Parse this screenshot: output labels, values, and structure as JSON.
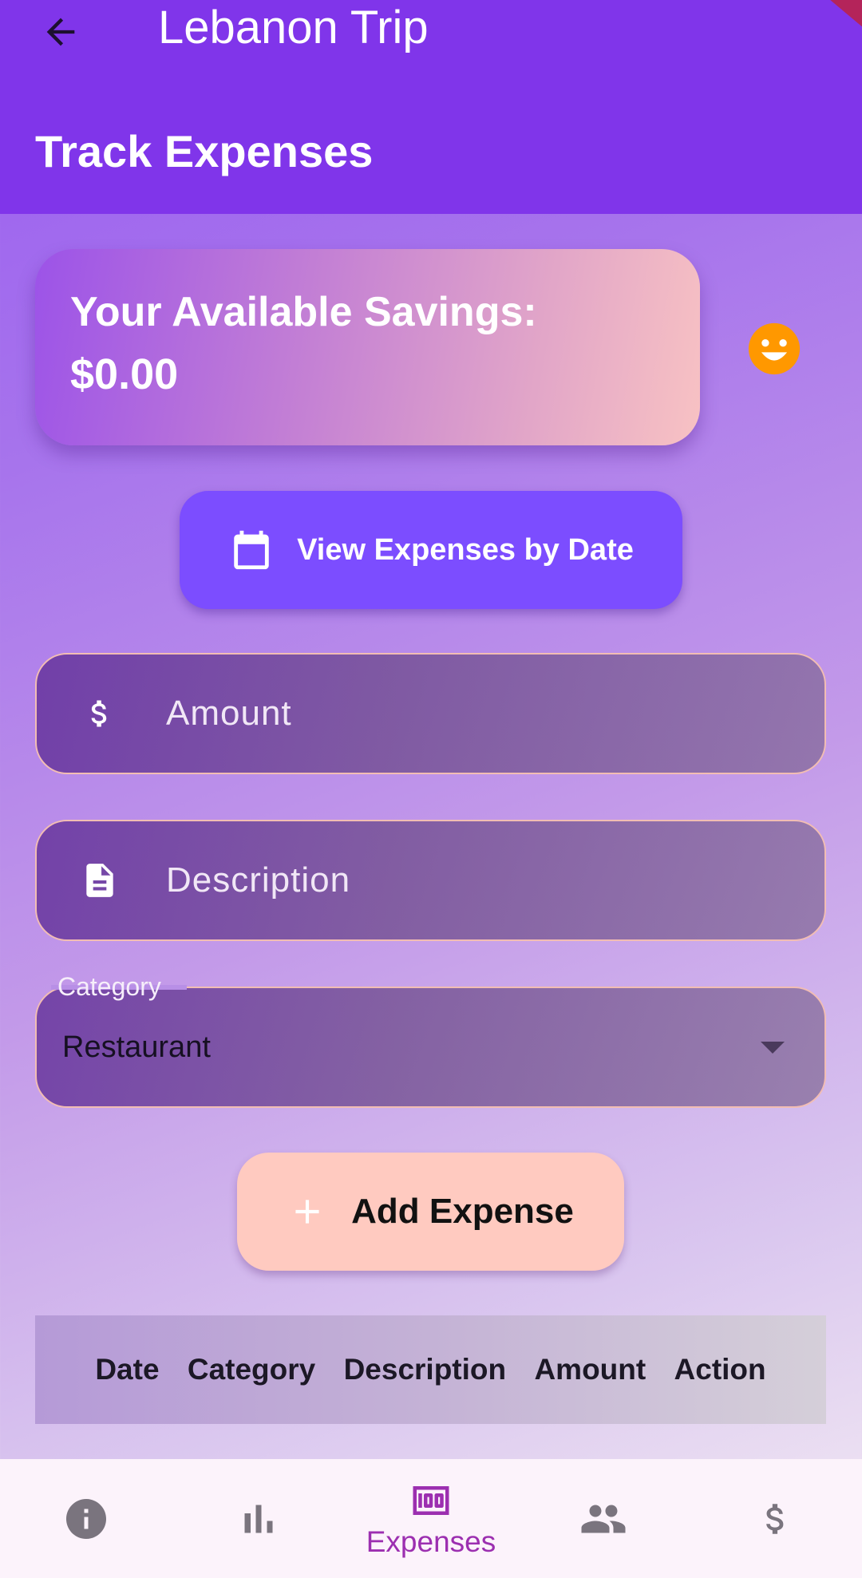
{
  "app_bar": {
    "title": "Lebanon Trip",
    "page_title": "Track Expenses"
  },
  "savings": {
    "label": "Your Available Savings:",
    "value": "$0.00"
  },
  "view_by_date": {
    "label": "View Expenses by Date"
  },
  "form": {
    "amount_placeholder": "Amount",
    "description_placeholder": "Description",
    "category_label": "Category",
    "category_value": "Restaurant",
    "add_label": "Add Expense"
  },
  "table": {
    "columns": [
      "Date",
      "Category",
      "Description",
      "Amount",
      "Action"
    ]
  },
  "bottom_nav": {
    "items": [
      {
        "icon": "info-icon",
        "label": "",
        "active": false
      },
      {
        "icon": "bar-chart-icon",
        "label": "",
        "active": false
      },
      {
        "icon": "money-icon",
        "label": "Expenses",
        "active": true
      },
      {
        "icon": "people-icon",
        "label": "",
        "active": false
      },
      {
        "icon": "dollar-icon",
        "label": "",
        "active": false
      }
    ]
  },
  "colors": {
    "app_bar": "#8035ea",
    "button_primary": "#7c4dff",
    "button_add": "#ffcac0",
    "nav_active": "#9c2fb0",
    "nav_inactive": "#7a747e",
    "smiley": "#ff9800"
  }
}
